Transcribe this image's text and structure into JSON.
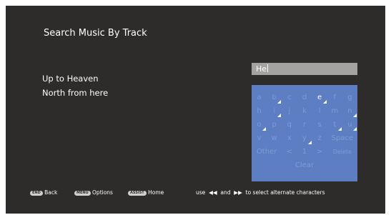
{
  "title": "Search Music By Track",
  "results": [
    "Up to Heaven",
    "North from here"
  ],
  "search": {
    "value": "He"
  },
  "keyboard": {
    "rows": [
      [
        {
          "label": "a"
        },
        {
          "label": "b",
          "mark": true
        },
        {
          "label": "c"
        },
        {
          "label": "d"
        },
        {
          "label": "e",
          "active": true,
          "mark": true
        },
        {
          "label": "f"
        },
        {
          "label": "g"
        }
      ],
      [
        {
          "label": "h"
        },
        {
          "label": "i",
          "mark": true
        },
        {
          "label": "j"
        },
        {
          "label": "k"
        },
        {
          "label": "l"
        },
        {
          "label": "m"
        },
        {
          "label": "n",
          "mark": true
        }
      ],
      [
        {
          "label": "o",
          "mark": true
        },
        {
          "label": "p"
        },
        {
          "label": "q"
        },
        {
          "label": "r"
        },
        {
          "label": "s"
        },
        {
          "label": "t",
          "mark": true
        },
        {
          "label": "u",
          "mark": true
        }
      ],
      [
        {
          "label": "v"
        },
        {
          "label": "w"
        },
        {
          "label": "x"
        },
        {
          "label": "y",
          "mark": true
        },
        {
          "label": "z"
        },
        {
          "label": "Space"
        }
      ],
      [
        {
          "label": "Other"
        },
        {
          "label": "<"
        },
        {
          "label": "1"
        },
        {
          "label": ">"
        },
        {
          "label": "Delete",
          "small": true
        }
      ],
      [
        {
          "label": "Clear"
        }
      ]
    ]
  },
  "footer": {
    "back": {
      "key": "END",
      "label": "Back"
    },
    "options": {
      "key": "MENU",
      "label": "Options"
    },
    "home": {
      "key": "ASSIST",
      "label": "Home"
    },
    "hint": {
      "prefix": "use",
      "left": "◀◀",
      "and": "and",
      "right": "▶▶",
      "suffix": "to select alternate characters"
    }
  },
  "colors": {
    "background": "#2e2b2b",
    "keyboard": "#5d7ec3",
    "key_text": "#7f9bd6",
    "field": "#a3a3a3"
  }
}
